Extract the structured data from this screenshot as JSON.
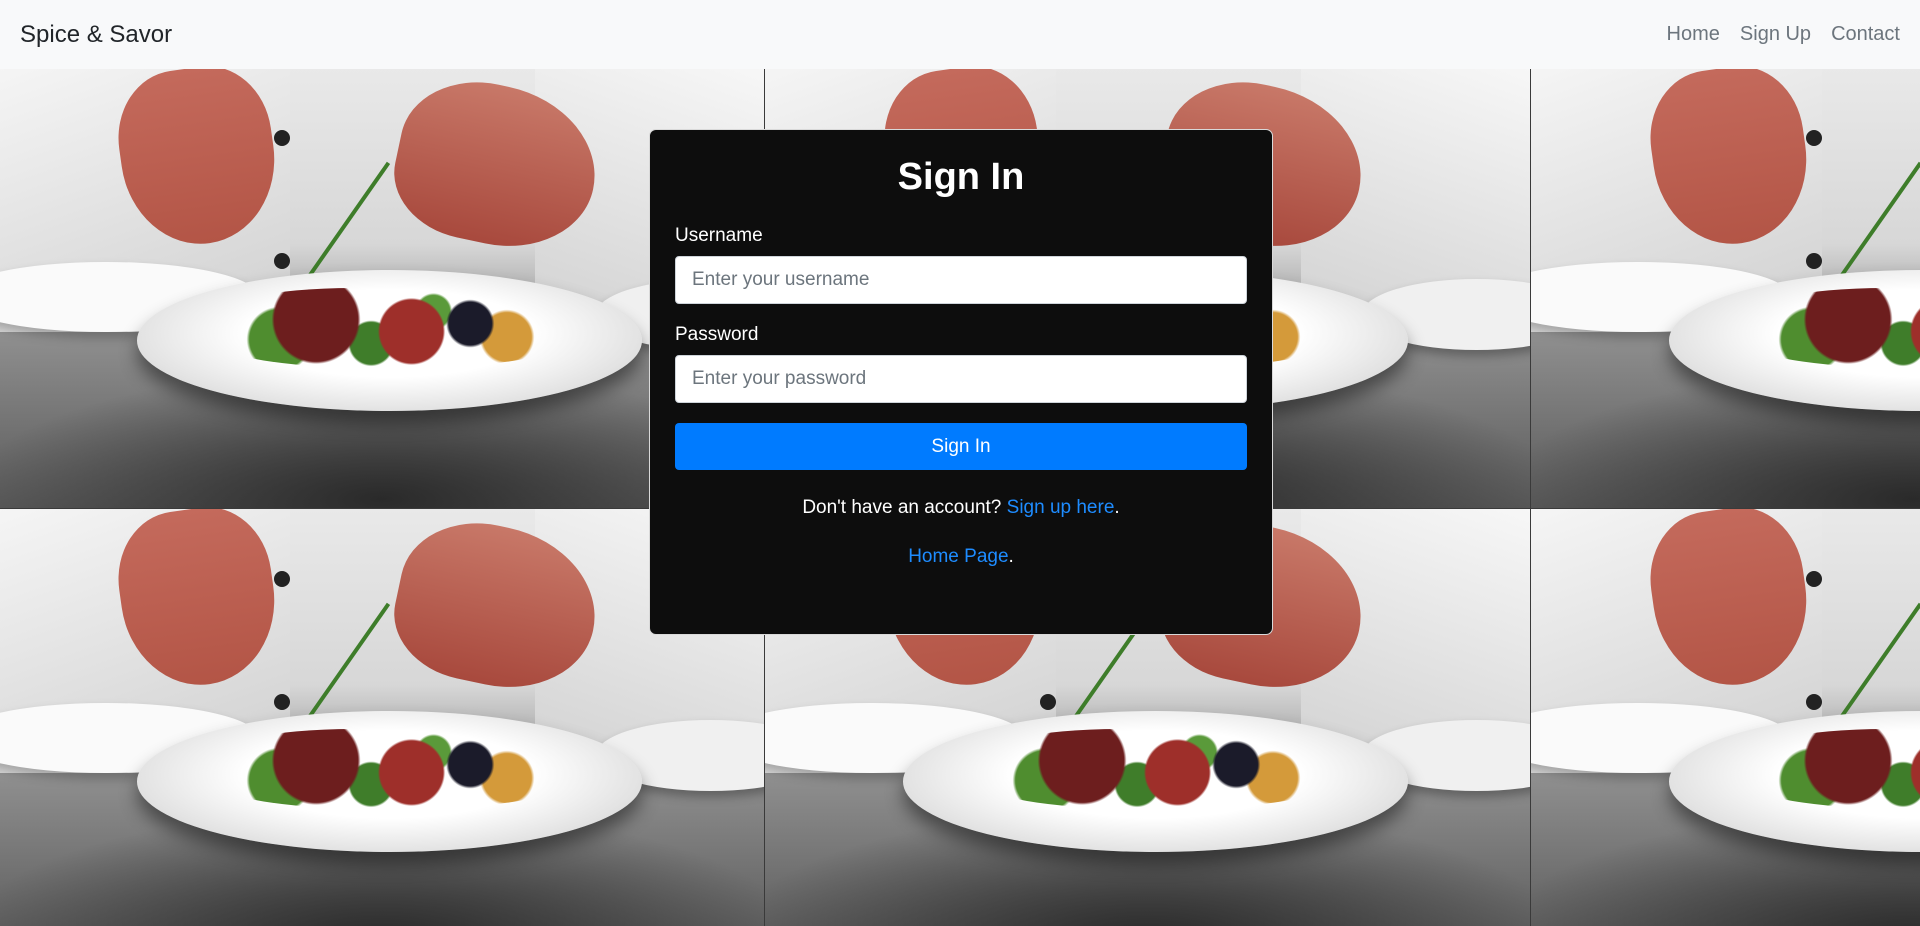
{
  "navbar": {
    "brand": "Spice & Savor",
    "links": [
      "Home",
      "Sign Up",
      "Contact"
    ]
  },
  "signin": {
    "title": "Sign In",
    "username_label": "Username",
    "username_placeholder": "Enter your username",
    "password_label": "Password",
    "password_placeholder": "Enter your password",
    "submit_label": "Sign In",
    "signup_prompt": "Don't have an account?",
    "signup_link": "Sign up here",
    "signup_suffix": ".",
    "home_link": "Home Page",
    "home_suffix": "."
  },
  "colors": {
    "primary": "#007bff",
    "link": "#1e8cff",
    "card_bg": "#0d0d0d",
    "navbar_bg": "#f8f9fa"
  }
}
